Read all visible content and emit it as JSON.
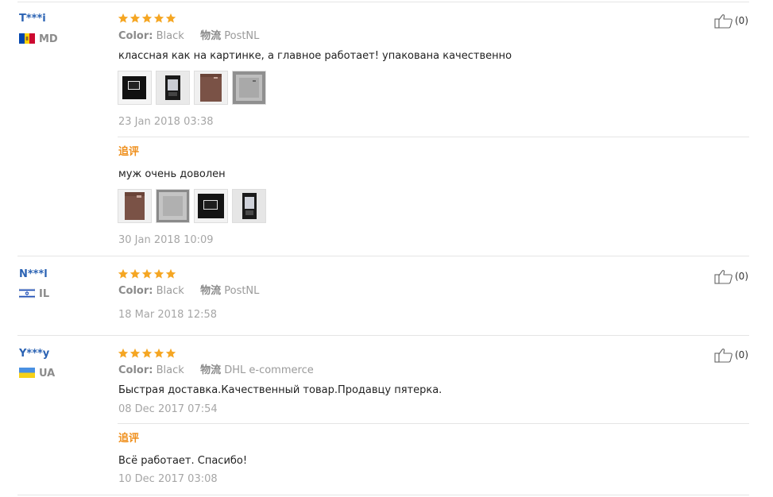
{
  "feedback": [
    {
      "buyer": "T***i",
      "country": "MD",
      "rating": 5,
      "color_label": "Color:",
      "color_value": "Black",
      "logistics_label": "物流",
      "logistics_value": "PostNL",
      "text": "классная как на картинке, а главное работает! упакована качественно",
      "photos": [
        "product-front-photo",
        "device-front-photo",
        "brown-box-photo",
        "gray-package-photo"
      ],
      "date": "23 Jan 2018 03:38",
      "additional": {
        "label": "追评",
        "text": "муж очень доволен",
        "photos": [
          "brown-box-photo",
          "gray-package-photo",
          "product-front-photo",
          "device-front-photo"
        ],
        "date": "30 Jan 2018 10:09"
      },
      "likes": "(0)"
    },
    {
      "buyer": "N***l",
      "country": "IL",
      "rating": 5,
      "color_label": "Color:",
      "color_value": "Black",
      "logistics_label": "物流",
      "logistics_value": "PostNL",
      "date": "18 Mar 2018 12:58",
      "likes": "(0)"
    },
    {
      "buyer": "Y***y",
      "country": "UA",
      "rating": 5,
      "color_label": "Color:",
      "color_value": "Black",
      "logistics_label": "物流",
      "logistics_value": "DHL e-commerce",
      "text": "Быстрая доставка.Качественный товар.Продавцу пятерка.",
      "date": "08 Dec 2017 07:54",
      "additional": {
        "label": "追评",
        "text": "Всё работает. Спасибо!",
        "date": "10 Dec 2017 03:08"
      },
      "likes": "(0)"
    }
  ],
  "colors": {
    "buyer_name": "#2a62b3",
    "star": "#f5a623",
    "additional_label": "#ef8f1c",
    "border": "#e5e5e5"
  }
}
